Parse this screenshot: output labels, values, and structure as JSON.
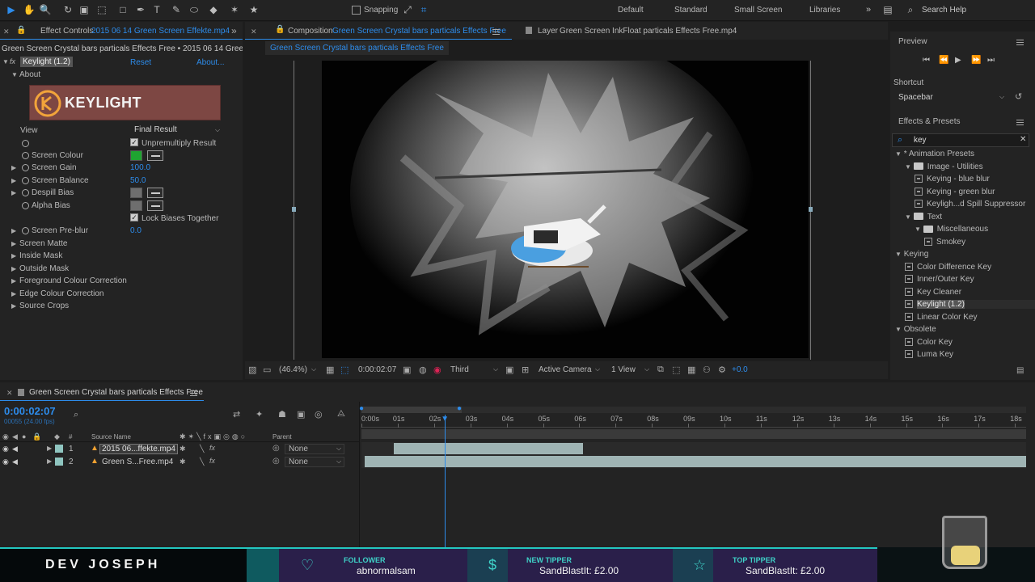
{
  "toolbar": {
    "snapping_label": "Snapping",
    "workspaces": [
      "Default",
      "Standard",
      "Small Screen",
      "Libraries"
    ],
    "search_placeholder": "Search Help"
  },
  "effect_controls": {
    "tab_prefix": "Effect Controls",
    "tab_file": "2015 06 14 Green Screen Effekte.mp4",
    "breadcrumb": "Green Screen Crystal bars particals Effects Free • 2015 06 14 Green Screen",
    "effect_name": "Keylight (1.2)",
    "reset_label": "Reset",
    "about_label": "About...",
    "about_row": "About",
    "logo_text": "KEYLIGHT",
    "view_label": "View",
    "view_value": "Final Result",
    "unpremultiply_label": "Unpremultiply Result",
    "screen_colour_label": "Screen Colour",
    "screen_gain_label": "Screen Gain",
    "screen_gain_value": "100.0",
    "screen_balance_label": "Screen Balance",
    "screen_balance_value": "50.0",
    "despill_label": "Despill Bias",
    "alpha_bias_label": "Alpha Bias",
    "lock_label": "Lock Biases Together",
    "prebiur_label": "Screen Pre-blur",
    "prebiur_value": "0.0",
    "groups": [
      "Screen Matte",
      "Inside Mask",
      "Outside Mask",
      "Foreground Colour Correction",
      "Edge Colour Correction",
      "Source Crops"
    ],
    "screen_colour_hex": "#1fa431"
  },
  "composition": {
    "tab_prefix": "Composition",
    "tab_name": "Green Screen Crystal bars particals Effects Free",
    "breadcrumb": "Green Screen Crystal bars particals Effects Free",
    "layer_tab_prefix": "Layer",
    "layer_tab_name": "Green Screen InkFloat particals Effects Free.mp4",
    "zoom": "(46.4%)",
    "timecode": "0:00:02:07",
    "resolution": "Third",
    "camera": "Active Camera",
    "views": "1 View",
    "exposure": "+0.0"
  },
  "right_panel": {
    "preview_title": "Preview",
    "shortcut_label": "Shortcut",
    "shortcut_value": "Spacebar",
    "effects_title": "Effects & Presets",
    "search_value": "key",
    "tree": [
      {
        "label": "* Animation Presets",
        "kind": "root",
        "indent": 0
      },
      {
        "label": "Image - Utilities",
        "kind": "folder",
        "indent": 1
      },
      {
        "label": "Keying - blue blur",
        "kind": "fx",
        "indent": 2
      },
      {
        "label": "Keying - green blur",
        "kind": "fx",
        "indent": 2
      },
      {
        "label": "Keyligh...d Spill Suppressor",
        "kind": "fx",
        "indent": 2
      },
      {
        "label": "Text",
        "kind": "folder",
        "indent": 1
      },
      {
        "label": "Miscellaneous",
        "kind": "folder",
        "indent": 2
      },
      {
        "label": "Smokey",
        "kind": "fx",
        "indent": 3
      },
      {
        "label": "Keying",
        "kind": "root",
        "indent": 0
      },
      {
        "label": "Color Difference Key",
        "kind": "fx",
        "indent": 1
      },
      {
        "label": "Inner/Outer Key",
        "kind": "fx",
        "indent": 1
      },
      {
        "label": "Key Cleaner",
        "kind": "fx",
        "indent": 1
      },
      {
        "label": "Keylight (1.2)",
        "kind": "fx-selected",
        "indent": 1
      },
      {
        "label": "Linear Color Key",
        "kind": "fx",
        "indent": 1
      },
      {
        "label": "Obsolete",
        "kind": "root",
        "indent": 0
      },
      {
        "label": "Color Key",
        "kind": "fx",
        "indent": 1
      },
      {
        "label": "Luma Key",
        "kind": "fx",
        "indent": 1
      }
    ]
  },
  "timeline": {
    "tab_name": "Green Screen Crystal bars particals Effects Free",
    "timecode": "0:00:02:07",
    "fps": "00055 (24.00 fps)",
    "source_name_header": "Source Name",
    "parent_header": "Parent",
    "layers": [
      {
        "num": "1",
        "name": "2015 06...ffekte.mp4",
        "parent": "None"
      },
      {
        "num": "2",
        "name": "Green S...Free.mp4",
        "parent": "None"
      }
    ],
    "ruler": [
      "0:00s",
      "01s",
      "02s",
      "03s",
      "04s",
      "05s",
      "06s",
      "07s",
      "08s",
      "09s",
      "10s",
      "11s",
      "12s",
      "13s",
      "14s",
      "15s",
      "16s",
      "17s",
      "18s"
    ],
    "playhead_seconds": 2.3,
    "layer1_in_seconds": 0.9,
    "layer1_out_seconds": 6.1
  },
  "stream_overlay": {
    "name": "DEV JOSEPH",
    "follower_label": "FOLLOWER",
    "follower_value": "abnormalsam",
    "new_tipper_label": "NEW TIPPER",
    "new_tipper_value": "SandBlastIt: £2.00",
    "top_tipper_label": "TOP TIPPER",
    "top_tipper_value": "SandBlastIt: £2.00"
  }
}
